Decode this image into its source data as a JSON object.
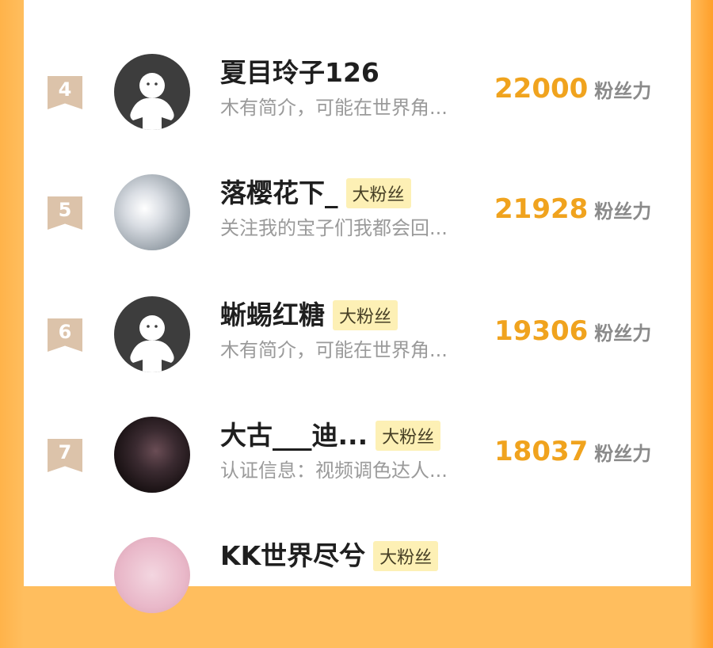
{
  "colors": {
    "background_orange": "#ffbe5e",
    "card_white": "#ffffff",
    "rank_flag": "#dcc3aa",
    "score_orange": "#f0a31e",
    "badge_yellow": "#fdf0b5",
    "text_dark": "#1f1f1f",
    "text_gray": "#9a9a9a"
  },
  "unit_label": "粉丝力",
  "badge_label": "大粉丝",
  "rows": [
    {
      "rank": "4",
      "name": "夏目玲子126",
      "has_badge": false,
      "desc": "木有简介，可能在世界角...",
      "score": "22000",
      "avatar_icon": "default-avatar-icon"
    },
    {
      "rank": "5",
      "name": "落樱花下_",
      "has_badge": true,
      "desc": "关注我的宝子们我都会回...",
      "score": "21928",
      "avatar_icon": "user-photo-avatar"
    },
    {
      "rank": "6",
      "name": "蜥蜴红糖",
      "has_badge": true,
      "desc": "木有简介，可能在世界角...",
      "score": "19306",
      "avatar_icon": "default-avatar-icon"
    },
    {
      "rank": "7",
      "name": "大古___迪...",
      "has_badge": true,
      "desc": "认证信息：视频调色达人...",
      "score": "18037",
      "avatar_icon": "user-photo-avatar"
    },
    {
      "name": "KK世界尽兮",
      "has_badge": true,
      "avatar_icon": "user-photo-avatar"
    }
  ]
}
